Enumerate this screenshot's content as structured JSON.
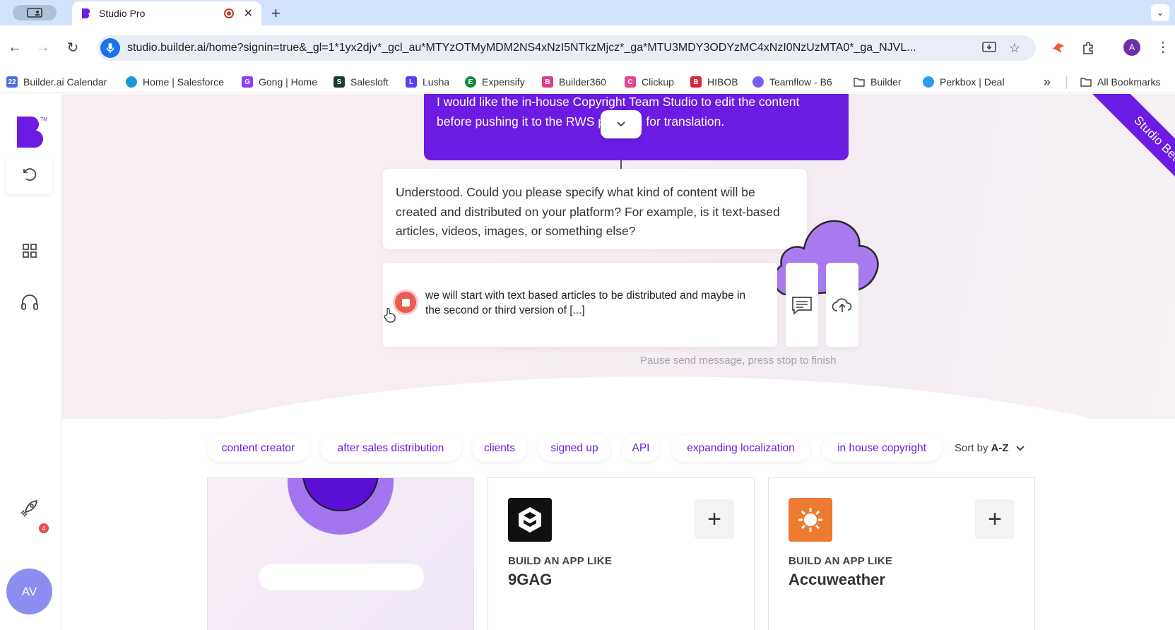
{
  "browser": {
    "tab_title": "Studio Pro",
    "url": "studio.builder.ai/home?signin=true&_gl=1*1yx2djv*_gcl_au*MTYzOTMyMDM2NS4xNzI5NTkzMjcz*_ga*MTU3MDY3ODYzMC4xNzI0NzUzMTA0*_ga_NJVL...",
    "profile_initial": "A",
    "bookmarks": [
      {
        "label": "Builder.ai Calendar",
        "icon": "calendar-icon",
        "color": "#4a6fdc"
      },
      {
        "label": "Home | Salesforce",
        "icon": "salesforce-cloud-icon",
        "color": "#1a9ad8"
      },
      {
        "label": "Gong | Home",
        "icon": "gong-icon",
        "color": "#8a3ffc"
      },
      {
        "label": "Salesloft",
        "icon": "salesloft-icon",
        "color": "#1f3d2b"
      },
      {
        "label": "Lusha",
        "icon": "lusha-icon",
        "color": "#5b3df5"
      },
      {
        "label": "Expensify",
        "icon": "expensify-icon",
        "color": "#0b8a3e"
      },
      {
        "label": "Builder360",
        "icon": "builder-icon",
        "color": "#e03c8a"
      },
      {
        "label": "Clickup",
        "icon": "clickup-icon",
        "color": "#e84393"
      },
      {
        "label": "HIBOB",
        "icon": "hibob-icon",
        "color": "#d7263d"
      },
      {
        "label": "Teamflow - B6",
        "icon": "teamflow-icon",
        "color": "#7b5cf5"
      },
      {
        "label": "Builder",
        "icon": "folder-icon",
        "color": "#555555"
      },
      {
        "label": "Perkbox | Deal",
        "icon": "perkbox-icon",
        "color": "#2a9df4"
      }
    ],
    "bookmarks_overflow": "»",
    "all_bookmarks": "All Bookmarks"
  },
  "app": {
    "brand_color": "#6c1be2",
    "beta_ribbon": "Studio Beta",
    "user_initials": "AV",
    "rocket_badge": "4",
    "user_message": "I would like the in-house Copyright Team Studio to edit the content before pushing it to the RWS platform for translation.",
    "bot_message": "Understood. Could you please specify what kind of content will be created and distributed on your platform? For example, is it text-based articles, videos, images, or something else?",
    "input_text": "we will start with text based articles to be distributed and maybe in the second or third version of [...]",
    "hint": "Pause send message, press stop to finish",
    "chips": [
      "content creator",
      "after sales distribution",
      "clients",
      "signed up",
      "API",
      "expanding localization",
      "in house copyright"
    ],
    "sort_label": "Sort by",
    "sort_value": "A-Z",
    "cards": [
      {
        "kicker": "BUILD AN APP LIKE",
        "name": "9GAG",
        "logo": "9gag-logo-icon",
        "logo_color": "#111111"
      },
      {
        "kicker": "BUILD AN APP LIKE",
        "name": "Accuweather",
        "logo": "accuweather-sun-icon",
        "logo_color": "#ef7b32"
      }
    ]
  }
}
